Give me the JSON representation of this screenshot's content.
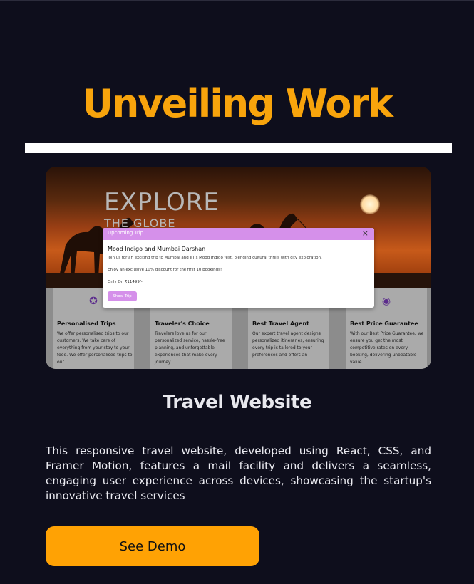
{
  "section": {
    "title": "Unveiling Work"
  },
  "project": {
    "screenshot": {
      "hero_heading": "EXPLORE",
      "hero_subheading": "THE GLOBE",
      "modal": {
        "header": "Upcoming Trip",
        "close_icon": "×",
        "trip_name": "Mood Indigo and Mumbai Darshan",
        "description": "Join us for an exciting trip to Mumbai and IIT's Mood Indigo fest, blending cultural thrills with city exploration.",
        "offer": "Enjoy an exclusive 10% discount for the first 10 bookings!",
        "price": "Only On ₹11499/-",
        "button": "Show Trip"
      },
      "cards": [
        {
          "icon": "medal-icon",
          "title": "Personalised Trips",
          "body": "We offer personalised trips to our customers. We take care of everything from your stay to your food. We offer personalised trips to our"
        },
        {
          "icon": "star-icon",
          "title": "Traveler's Choice",
          "body": "Travelers love us for our personalized service, hassle-free planning, and unforgettable experiences that make every journey"
        },
        {
          "icon": "agent-icon",
          "title": "Best Travel Agent",
          "body": "Our expert travel agent designs personalized itineraries, ensuring every trip is tailored to your preferences and offers an"
        },
        {
          "icon": "badge-icon",
          "title": "Best Price Guarantee",
          "body": "With our Best Price Guarantee, we ensure you get the most competitive rates on every booking, delivering unbeatable value"
        }
      ]
    },
    "name": "Travel Website",
    "description": "This responsive travel website, developed using React, CSS, and Framer Motion, features a mail facility and delivers a seamless, engaging user experience across devices, showcasing the startup's innovative travel services",
    "demo_button": "See Demo"
  },
  "colors": {
    "background": "#0e0e1c",
    "accent": "#f8a40c",
    "modal_accent": "#d590ea"
  }
}
